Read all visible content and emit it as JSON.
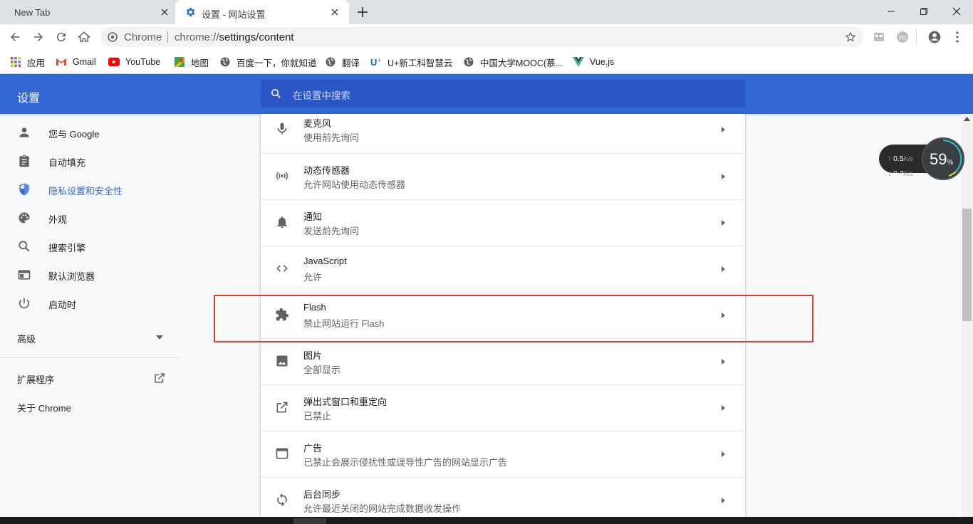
{
  "tabs": [
    {
      "title": "New Tab",
      "active": false
    },
    {
      "title": "设置 - 网站设置",
      "active": true
    }
  ],
  "omnibox": {
    "site_name": "Chrome",
    "url_scheme": "chrome://",
    "url_path": "settings/content"
  },
  "bookmarks": [
    {
      "label": "应用",
      "icon": "apps-grid-icon"
    },
    {
      "label": "Gmail",
      "icon": "gmail-icon"
    },
    {
      "label": "YouTube",
      "icon": "youtube-icon"
    },
    {
      "label": "地图",
      "icon": "maps-icon"
    },
    {
      "label": "百度一下，你就知道",
      "icon": "globe-icon"
    },
    {
      "label": "翻译",
      "icon": "globe-icon"
    },
    {
      "label": "U+新工科智慧云",
      "icon": "u-plus-icon"
    },
    {
      "label": "中国大学MOOC(慕...",
      "icon": "globe-icon"
    },
    {
      "label": "Vue.js",
      "icon": "vue-icon"
    }
  ],
  "header": {
    "title": "设置",
    "search_placeholder": "在设置中搜索"
  },
  "sidebar": {
    "items": [
      {
        "label": "您与 Google",
        "icon": "person-icon",
        "active": false
      },
      {
        "label": "自动填充",
        "icon": "clipboard-icon",
        "active": false
      },
      {
        "label": "隐私设置和安全性",
        "icon": "shield-icon",
        "active": true
      },
      {
        "label": "外观",
        "icon": "palette-icon",
        "active": false
      },
      {
        "label": "搜索引擎",
        "icon": "search-icon",
        "active": false
      },
      {
        "label": "默认浏览器",
        "icon": "browser-window-icon",
        "active": false
      },
      {
        "label": "启动时",
        "icon": "power-icon",
        "active": false
      }
    ],
    "advanced": "高级",
    "extensions": "扩展程序",
    "about": "关于 Chrome"
  },
  "content_rows": [
    {
      "title": "麦克风",
      "subtitle": "使用前先询问",
      "icon": "microphone-icon"
    },
    {
      "title": "动态传感器",
      "subtitle": "允许网站使用动态传感器",
      "icon": "sensors-icon"
    },
    {
      "title": "通知",
      "subtitle": "发送前先询问",
      "icon": "bell-icon"
    },
    {
      "title": "JavaScript",
      "subtitle": "允许",
      "icon": "code-icon"
    },
    {
      "title": "Flash",
      "subtitle": "禁止网站运行 Flash",
      "icon": "puzzle-icon"
    },
    {
      "title": "图片",
      "subtitle": "全部显示",
      "icon": "image-icon"
    },
    {
      "title": "弹出式窗口和重定向",
      "subtitle": "已禁止",
      "icon": "open-in-new-icon"
    },
    {
      "title": "广告",
      "subtitle": "已禁止会展示侵扰性或误导性广告的网站显示广告",
      "icon": "ad-window-icon"
    },
    {
      "title": "后台同步",
      "subtitle": "允许最近关闭的网站完成数据收发操作",
      "icon": "sync-icon"
    }
  ],
  "net_widget": {
    "upload": "0.5",
    "download": "0.2",
    "unit": "K/s",
    "percent": "59",
    "percent_sign": "%"
  },
  "colors": {
    "accent": "#3367d6",
    "highlight_box": "#e53935"
  }
}
